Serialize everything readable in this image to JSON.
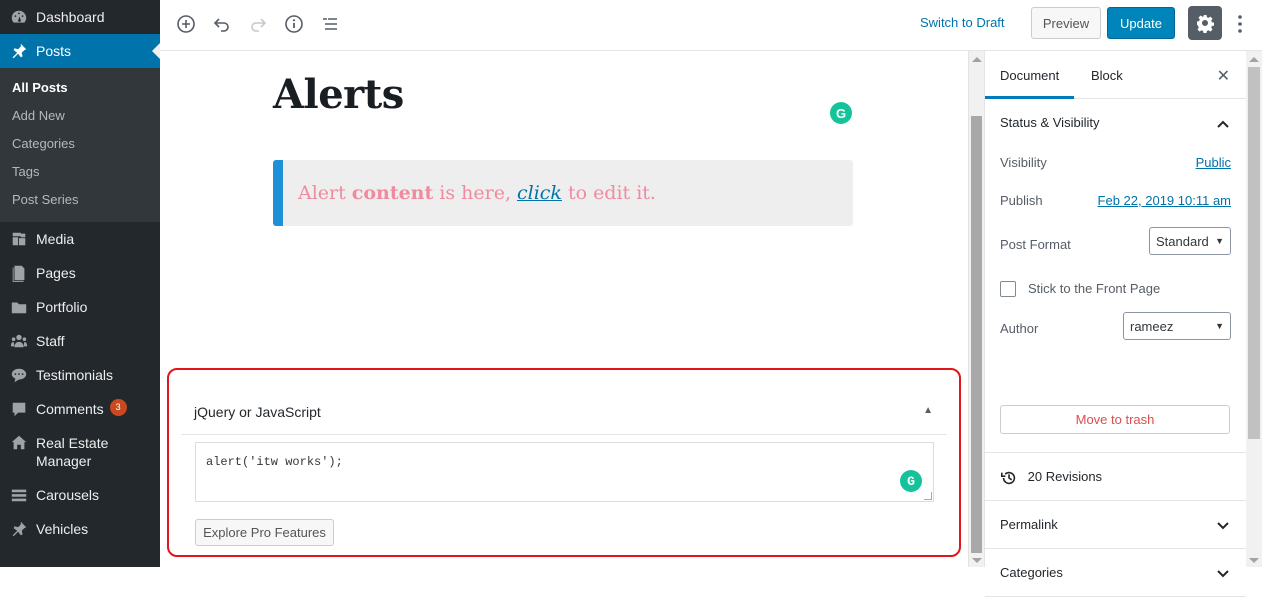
{
  "admin_menu": {
    "dashboard": "Dashboard",
    "posts": "Posts",
    "posts_submenu": [
      "All Posts",
      "Add New",
      "Categories",
      "Tags",
      "Post Series"
    ],
    "media": "Media",
    "pages": "Pages",
    "portfolio": "Portfolio",
    "staff": "Staff",
    "testimonials": "Testimonials",
    "comments": "Comments",
    "comments_count": "3",
    "real_estate_line1": "Real Estate",
    "real_estate_line2": "Manager",
    "carousels": "Carousels",
    "vehicles": "Vehicles"
  },
  "header": {
    "switch_to_draft": "Switch to Draft",
    "preview": "Preview",
    "update": "Update"
  },
  "editor": {
    "title": "Alerts",
    "alert": {
      "prefix": "Alert",
      "bold": "content",
      "middle": "is here,",
      "link": "click",
      "suffix": "to edit it."
    },
    "grammarly_letter": "G"
  },
  "metabox": {
    "title": "jQuery or JavaScript",
    "code": "alert('itw works');",
    "explore_button": "Explore Pro Features"
  },
  "settings": {
    "tabs": [
      "Document",
      "Block"
    ],
    "status_visibility": {
      "title": "Status & Visibility",
      "visibility_label": "Visibility",
      "visibility_value": "Public",
      "publish_label": "Publish",
      "publish_value": "Feb 22, 2019 10:11 am",
      "post_format_label": "Post Format",
      "post_format_value": "Standard",
      "sticky_label": "Stick to the Front Page",
      "author_label": "Author",
      "author_value": "rameez",
      "trash_button": "Move to trash"
    },
    "revisions": "20 Revisions",
    "permalink": "Permalink",
    "categories": "Categories"
  },
  "colors": {
    "wp_blue": "#0073aa",
    "admin_bar": "#23282d",
    "alert_border": "#1e90d8",
    "alert_text": "#f08b9f",
    "highlight_box": "#e0161c",
    "grammarly": "#15c39a"
  }
}
